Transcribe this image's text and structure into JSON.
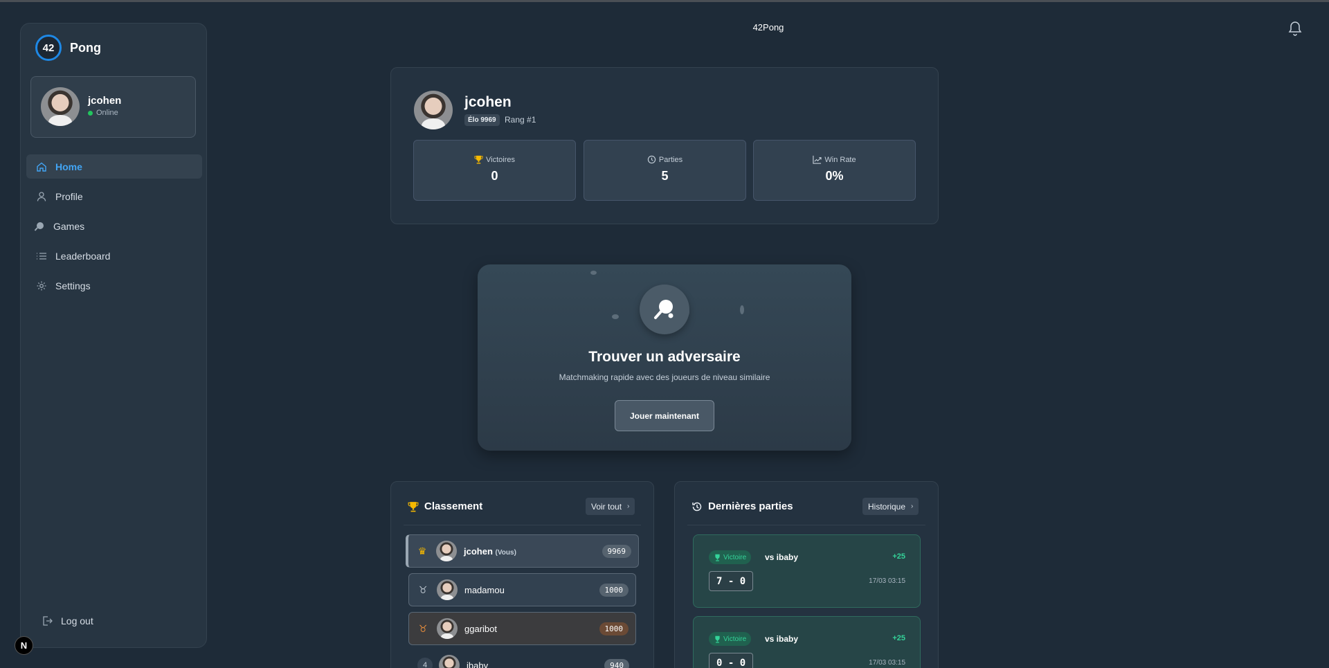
{
  "app": {
    "title": "42Pong",
    "brand_logo": "42",
    "brand_name": "Pong"
  },
  "sidebar": {
    "user": {
      "name": "jcohen",
      "status": "Online"
    },
    "items": [
      {
        "label": "Home",
        "icon": "home-icon",
        "active": true
      },
      {
        "label": "Profile",
        "icon": "user-icon"
      },
      {
        "label": "Games",
        "icon": "ping-pong-icon"
      },
      {
        "label": "Leaderboard",
        "icon": "list-icon"
      },
      {
        "label": "Settings",
        "icon": "gear-icon"
      }
    ],
    "logout": "Log out"
  },
  "profile": {
    "name": "jcohen",
    "elo_badge": "Élo 9969",
    "rank": "Rang #1",
    "stats": [
      {
        "label": "Victoires",
        "value": "0",
        "icon": "trophy-icon"
      },
      {
        "label": "Parties",
        "value": "5",
        "icon": "clock-icon"
      },
      {
        "label": "Win Rate",
        "value": "0%",
        "icon": "trend-icon"
      }
    ]
  },
  "matchmaking": {
    "title": "Trouver un adversaire",
    "subtitle": "Matchmaking rapide avec des joueurs de niveau similaire",
    "button": "Jouer maintenant"
  },
  "ranking": {
    "title": "Classement",
    "view_all": "Voir tout",
    "rows": [
      {
        "name": "jcohen",
        "tag": "(Vous)",
        "elo": "9969"
      },
      {
        "name": "madamou",
        "elo": "1000"
      },
      {
        "name": "ggaribot",
        "elo": "1000"
      },
      {
        "rank": "4",
        "name": "ibaby",
        "elo": "940"
      }
    ]
  },
  "recent": {
    "title": "Dernières parties",
    "history": "Historique",
    "games": [
      {
        "result": "Victoire",
        "opponent": "vs ibaby",
        "gain": "+25",
        "score": "7 - 0",
        "date": "17/03 03:15"
      },
      {
        "result": "Victoire",
        "opponent": "vs ibaby",
        "gain": "+25",
        "score": "0 - 0",
        "date": "17/03 03:15"
      }
    ]
  },
  "misc": {
    "next_badge": "N"
  },
  "colors": {
    "accent": "#42a5f5",
    "win": "#34d399",
    "background": "#1e2b38"
  }
}
